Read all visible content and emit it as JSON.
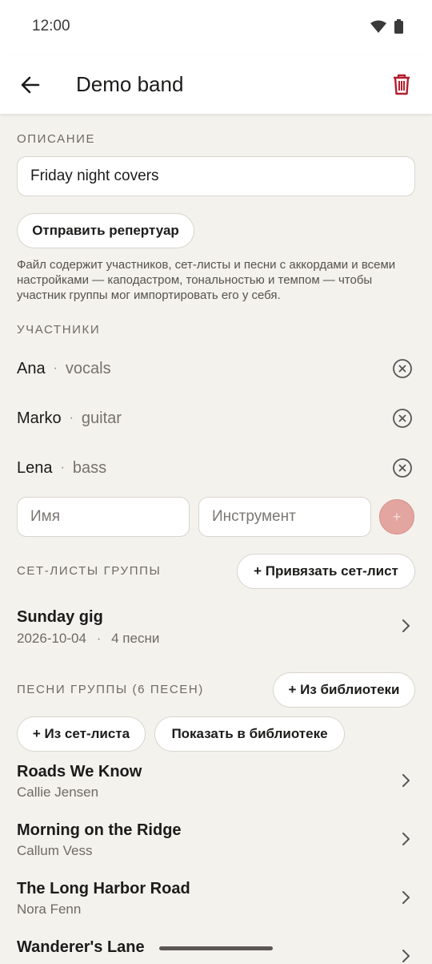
{
  "status": {
    "time": "12:00"
  },
  "header": {
    "title": "Demo band"
  },
  "description": {
    "label": "ОПИСАНИЕ",
    "value": "Friday night covers",
    "send_button": "Отправить репертуар",
    "hint": "Файл содержит участников, сет-листы и песни с аккордами и всеми настройками — каподастром, тональностью и темпом — чтобы участник группы мог импортировать его у себя."
  },
  "members": {
    "label": "УЧАСТНИКИ",
    "items": [
      {
        "name": "Ana",
        "role": "vocals"
      },
      {
        "name": "Marko",
        "role": "guitar"
      },
      {
        "name": "Lena",
        "role": "bass"
      }
    ],
    "separator": "·",
    "name_placeholder": "Имя",
    "instrument_placeholder": "Инструмент",
    "add_symbol": "+"
  },
  "setlists": {
    "label": "СЕТ-ЛИСТЫ ГРУППЫ",
    "attach_button": "+ Привязать сет-лист",
    "items": [
      {
        "title": "Sunday gig",
        "date": "2026-10-04",
        "songs": "4 песни"
      }
    ]
  },
  "songs": {
    "label": "ПЕСНИ ГРУППЫ (6 ПЕСЕН)",
    "from_library_button": "+ Из библиотеки",
    "from_setlist_button": "+ Из сет-листа",
    "show_in_library_button": "Показать в библиотеке",
    "items": [
      {
        "title": "Roads We Know",
        "artist": "Callie Jensen"
      },
      {
        "title": "Morning on the Ridge",
        "artist": "Callum Vess"
      },
      {
        "title": "The Long Harbor Road",
        "artist": "Nora Fenn"
      },
      {
        "title": "Wanderer's Lane",
        "artist": ""
      }
    ]
  },
  "colors": {
    "accent": "#b3202e",
    "background": "#f4f2ed",
    "add_button": "#e3a59f"
  }
}
